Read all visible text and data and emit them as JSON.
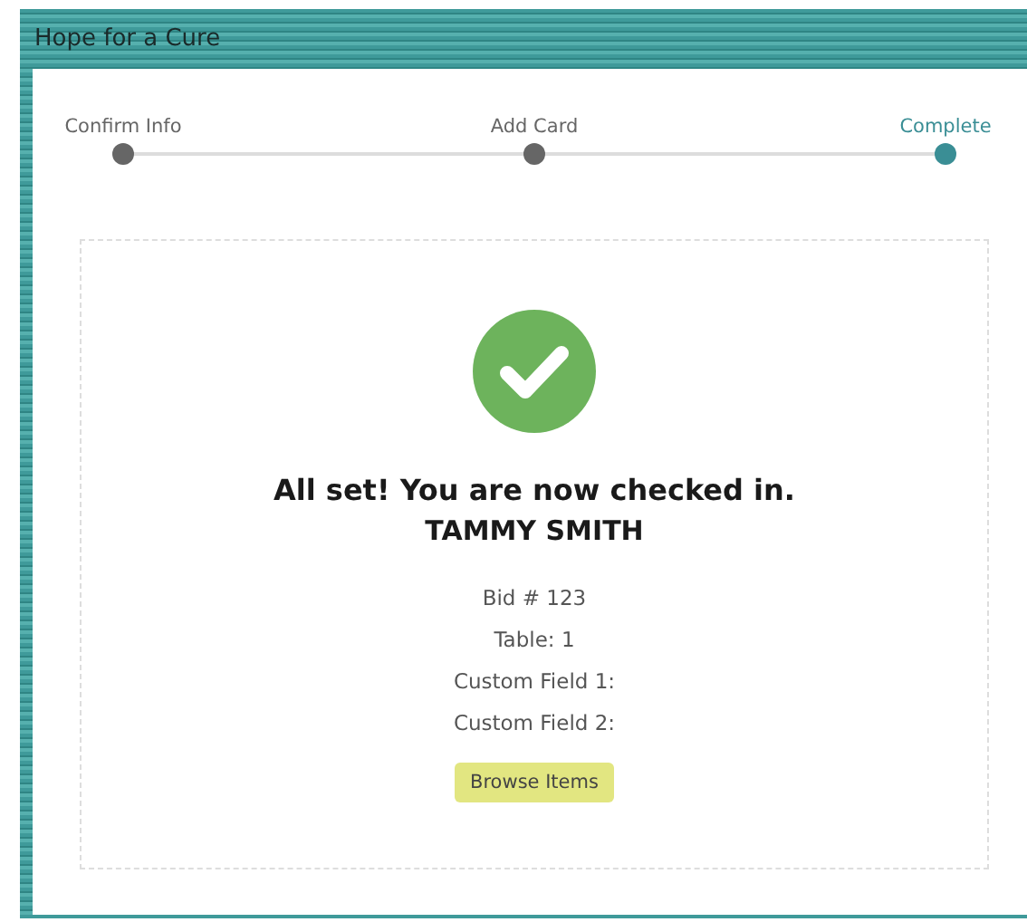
{
  "header": {
    "title": "Hope for a Cure"
  },
  "steps": [
    {
      "label": "Confirm Info",
      "selected": false
    },
    {
      "label": "Add Card",
      "selected": false
    },
    {
      "label": "Complete",
      "selected": true
    }
  ],
  "confirmation": {
    "heading": "All set! You are now checked in.",
    "name": "TAMMY SMITH",
    "details": [
      "Bid # 123",
      "Table: 1",
      "Custom Field 1:",
      "Custom Field 2:"
    ],
    "button": "Browse Items"
  }
}
